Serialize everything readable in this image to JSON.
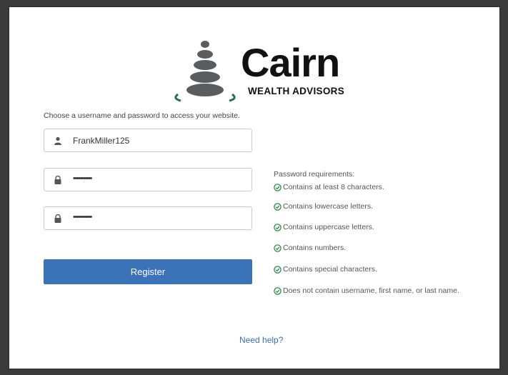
{
  "brand": {
    "name": "Cairn",
    "tagline": "WEALTH ADVISORS",
    "stone_color": "#5a5d60",
    "accent_color": "#2a6f4c"
  },
  "form": {
    "instruction": "Choose a username and password to access your website.",
    "username": {
      "icon": "user-icon",
      "value": "FrankMiller125"
    },
    "password": {
      "icon": "lock-icon",
      "value": "•••••••••••"
    },
    "confirm_password": {
      "icon": "lock-icon",
      "value": "•••••••••••"
    },
    "register_label": "Register",
    "button_color": "#3b73b9"
  },
  "requirements": {
    "title": "Password requirements:",
    "check_icon": "check-circle-icon",
    "check_color": "#2a8a4a",
    "items": [
      "Contains at least 8 characters.",
      "Contains lowercase letters.",
      "Contains uppercase letters.",
      "Contains numbers.",
      "Contains special characters.",
      "Does not contain username, first name, or last name."
    ]
  },
  "help": {
    "label": "Need help?"
  }
}
